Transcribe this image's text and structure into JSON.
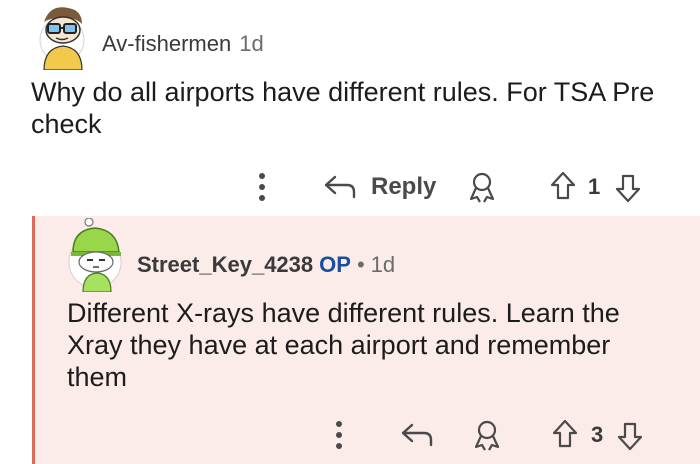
{
  "comment1": {
    "username": "Av-fishermen",
    "age": "1d",
    "body": "Why do all airports have different rules. For TSA Pre check",
    "reply_label": "Reply",
    "vote_count": "1"
  },
  "comment2": {
    "username": "Street_Key_4238",
    "op_badge": "OP",
    "separator": "•",
    "age": "1d",
    "body": "Different X-rays have different rules. Learn the Xray they have at each airport and remember them",
    "vote_count": "3"
  },
  "colors": {
    "reply_background": "#fbebe9",
    "thread_line": "#e06a5a",
    "op_blue": "#1a4fa0"
  },
  "icons": [
    "more-options-icon",
    "reply-arrow-icon",
    "award-icon",
    "upvote-icon",
    "downvote-icon"
  ]
}
